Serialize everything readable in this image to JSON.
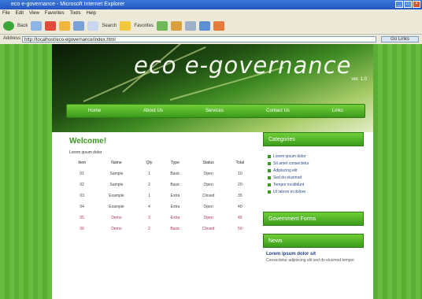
{
  "window": {
    "title": "eco e-governance - Microsoft Internet Explorer"
  },
  "menu": [
    "File",
    "Edit",
    "View",
    "Favorites",
    "Tools",
    "Help"
  ],
  "toolbar": {
    "back_label": "Back",
    "search_label": "Search",
    "favorites_label": "Favorites"
  },
  "address": {
    "label": "Address",
    "url": "http://localhost/eco-egovernance/index.html",
    "go_label": "Go Links"
  },
  "site": {
    "title": "eco e-governance",
    "tagline": "ver. 1.0"
  },
  "nav": [
    "Home",
    "About Us",
    "Services",
    "Contact Us",
    "Links"
  ],
  "content": {
    "heading": "Welcome!",
    "intro": "Lorem ipsum dolor",
    "table": {
      "headers": [
        "Item",
        "Name",
        "Qty",
        "Type",
        "Status",
        "Total"
      ],
      "rows": [
        [
          "01",
          "Sample",
          "1",
          "Basic",
          "Open",
          "10"
        ],
        [
          "02",
          "Sample",
          "2",
          "Basic",
          "Open",
          "20"
        ],
        [
          "03",
          "Example",
          "1",
          "Extra",
          "Closed",
          "35"
        ],
        [
          "04",
          "Example",
          "4",
          "Extra",
          "Open",
          "40"
        ],
        [
          "05",
          "Demo",
          "3",
          "Extra",
          "Open",
          "45"
        ],
        [
          "06",
          "Demo",
          "2",
          "Basic",
          "Closed",
          "50"
        ]
      ]
    }
  },
  "sidebar": {
    "box1_title": "Categories",
    "links": [
      "Lorem ipsum dolor",
      "Sit amet consectetur",
      "Adipiscing elit",
      "Sed do eiusmod",
      "Tempor incididunt",
      "Ut labore et dolore"
    ],
    "box2_title": "Government Forms",
    "box3_title": "News",
    "news": {
      "title": "Lorem ipsum dolor sit",
      "text": "Consectetur adipiscing elit sed do eiusmod tempor"
    }
  },
  "colors": {
    "accent": "#3a9a1e",
    "nav_top": "#72cf39",
    "nav_bottom": "#3b9a1c",
    "alt_text": "#b0325a"
  }
}
